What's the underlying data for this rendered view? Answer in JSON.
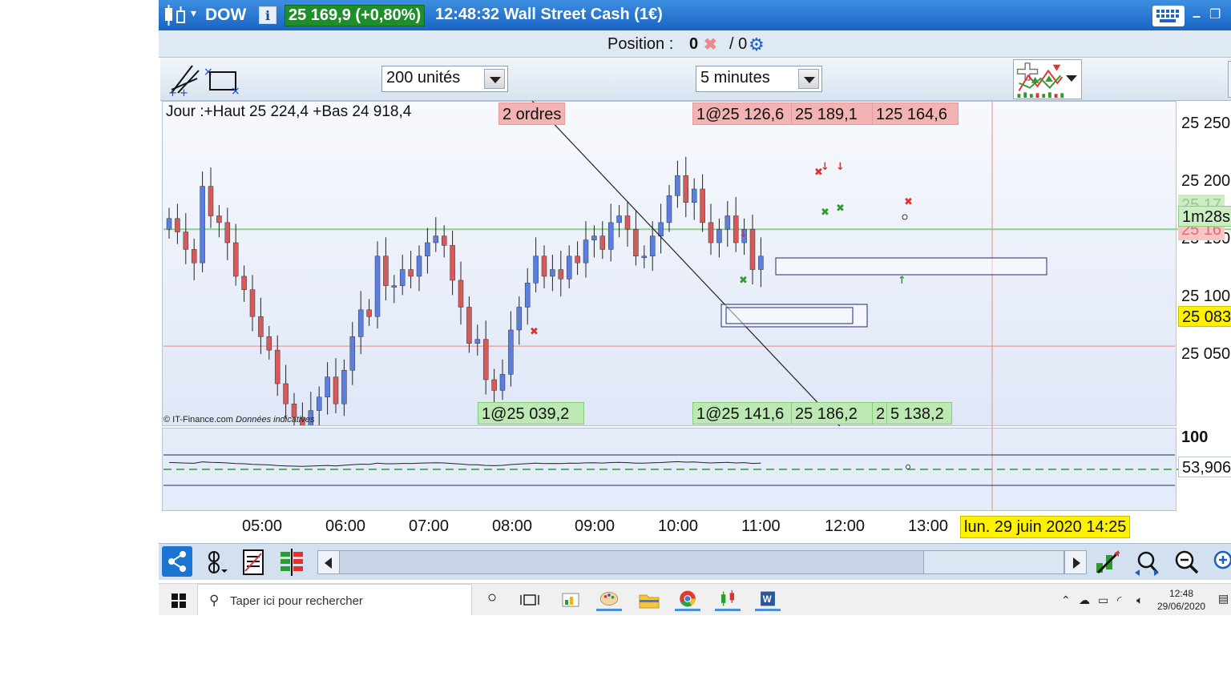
{
  "window": {
    "symbol": "DOW",
    "price_change": "25 169,9 (+0,80%)",
    "time_title": "12:48:32 Wall Street Cash (1€)",
    "info_icon": "info-icon",
    "colors": {
      "title_bg": "#1a64c4",
      "price_bg": "#1d8f2a"
    }
  },
  "position": {
    "label": "Position :",
    "value": "0",
    "value2": "/ 0"
  },
  "toolbar": {
    "units_value": "200 unités",
    "interval_value": "5 minutes"
  },
  "chart": {
    "day_info": "Jour :+Haut 25 224,4 +Bas 24 918,4",
    "orders_label": "2 ordres",
    "copyright": "© IT-Finance.com",
    "copyright_note": "Données indicatives",
    "top_labels": [
      "1@25 126,6",
      "25 189,1",
      "125 164,6"
    ],
    "bottom_labels": [
      "1@25 039,2",
      "1@25 141,6",
      "25 186,2",
      "2",
      "5 138,2"
    ],
    "price_axis": [
      "25 250",
      "25 200",
      "25 150",
      "25 100",
      "25 050"
    ],
    "axis_countdown": "1m28s",
    "axis_cursor_price": "25 083",
    "axis_partial_top": "25 17",
    "axis_partial_red": "25 16",
    "indicator_axis_top": "100",
    "indicator_value": "53,906",
    "time_axis": [
      "05:00",
      "06:00",
      "07:00",
      "08:00",
      "09:00",
      "10:00",
      "11:00",
      "12:00",
      "13:00"
    ],
    "date_cursor": "lun. 29 juin 2020 14:25",
    "colors": {
      "bull": "#5b7fe0",
      "bear": "#d65a5a",
      "last_price_line": "#8bd48b",
      "cursor_line": "#e88a8a"
    }
  },
  "chart_data": {
    "type": "candlestick",
    "title": "",
    "price_range": [
      25024,
      25265
    ],
    "x_ticks": [
      "05:00",
      "06:00",
      "07:00",
      "08:00",
      "09:00",
      "10:00",
      "11:00",
      "12:00",
      "13:00"
    ],
    "y_ticks": [
      25250,
      25200,
      25150,
      25100,
      25050
    ],
    "candles_close_approx": [
      25178,
      25168,
      25155,
      25145,
      25202,
      25180,
      25175,
      25160,
      25135,
      25125,
      25105,
      25090,
      25080,
      25055,
      25040,
      25030,
      25020,
      25035,
      25045,
      25060,
      25040,
      25065,
      25090,
      25110,
      25105,
      25150,
      25128,
      25128,
      25140,
      25135,
      25150,
      25160,
      25165,
      25158,
      25132,
      25112,
      25085,
      25088,
      25058,
      25050,
      25062,
      25095,
      25112,
      25130,
      25150,
      25135,
      25140,
      25133,
      25150,
      25145,
      25162,
      25165,
      25155,
      25175,
      25180,
      25170,
      25150,
      25150,
      25165,
      25175,
      25195,
      25210,
      25190,
      25200,
      25175,
      25160,
      25170,
      25180,
      25160,
      25170,
      25140,
      25150
    ]
  },
  "indicator": {
    "name": "",
    "level_dashed": 50,
    "last_value": 53.906
  },
  "taskbar": {
    "search_placeholder": "Taper ici pour rechercher",
    "clock_time": "12:48",
    "clock_date": "29/06/2020"
  }
}
